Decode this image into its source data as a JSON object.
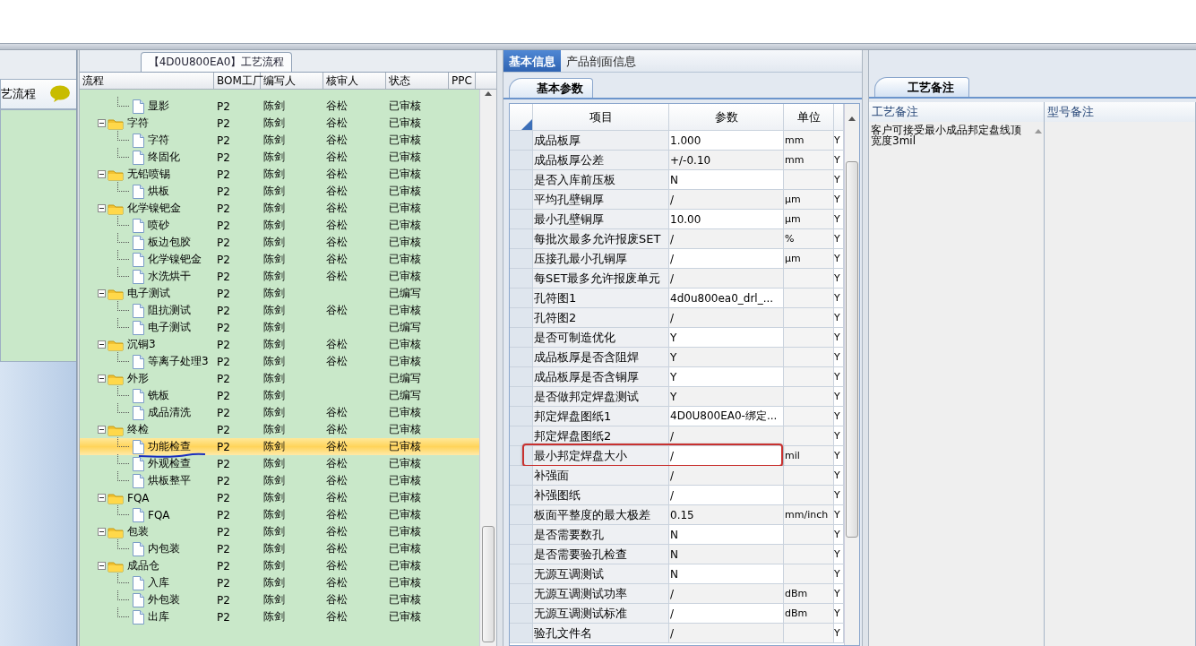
{
  "side_panel": {
    "title": "艺流程"
  },
  "flow_panel": {
    "tab": {
      "label": "【4D0U800EA0】工艺流程",
      "selected": true
    },
    "columns": [
      "流程",
      "BOM工厂",
      "编写人",
      "核审人",
      "状态",
      "PPC"
    ],
    "tree": [
      {
        "children": [
          {
            "label": "显影",
            "factory": "P2",
            "writer": "陈剑",
            "reviewer": "谷松",
            "status": "已审核",
            "selected": false
          }
        ]
      },
      {
        "label": "字符",
        "factory": "P2",
        "writer": "陈剑",
        "reviewer": "谷松",
        "status": "已审核",
        "selected": false,
        "expanded": true,
        "children": [
          {
            "label": "字符",
            "factory": "P2",
            "writer": "陈剑",
            "reviewer": "谷松",
            "status": "已审核",
            "selected": false
          },
          {
            "label": "终固化",
            "factory": "P2",
            "writer": "陈剑",
            "reviewer": "谷松",
            "status": "已审核",
            "selected": false
          }
        ]
      },
      {
        "label": "无铅喷锡",
        "factory": "P2",
        "writer": "陈剑",
        "reviewer": "谷松",
        "status": "已审核",
        "selected": false,
        "expanded": true,
        "children": [
          {
            "label": "烘板",
            "factory": "P2",
            "writer": "陈剑",
            "reviewer": "谷松",
            "status": "已审核",
            "selected": false
          }
        ]
      },
      {
        "label": "化学镍钯金",
        "factory": "P2",
        "writer": "陈剑",
        "reviewer": "谷松",
        "status": "已审核",
        "selected": false,
        "expanded": true,
        "children": [
          {
            "label": "喷砂",
            "factory": "P2",
            "writer": "陈剑",
            "reviewer": "谷松",
            "status": "已审核",
            "selected": false
          },
          {
            "label": "板边包胶",
            "factory": "P2",
            "writer": "陈剑",
            "reviewer": "谷松",
            "status": "已审核",
            "selected": false
          },
          {
            "label": "化学镍钯金",
            "factory": "P2",
            "writer": "陈剑",
            "reviewer": "谷松",
            "status": "已审核",
            "selected": false
          },
          {
            "label": "水洗烘干",
            "factory": "P2",
            "writer": "陈剑",
            "reviewer": "谷松",
            "status": "已审核",
            "selected": false
          }
        ]
      },
      {
        "label": "电子测试",
        "factory": "P2",
        "writer": "陈剑",
        "status": "已编写",
        "selected": false,
        "expanded": true,
        "children": [
          {
            "label": "阻抗测试",
            "factory": "P2",
            "writer": "陈剑",
            "reviewer": "谷松",
            "status": "已审核",
            "selected": false
          },
          {
            "label": "电子测试",
            "factory": "P2",
            "writer": "陈剑",
            "status": "已编写",
            "selected": false
          }
        ]
      },
      {
        "label": "沉铜3",
        "factory": "P2",
        "writer": "陈剑",
        "reviewer": "谷松",
        "status": "已审核",
        "selected": false,
        "expanded": true,
        "children": [
          {
            "label": "等离子处理3",
            "factory": "P2",
            "writer": "陈剑",
            "reviewer": "谷松",
            "status": "已审核",
            "selected": false
          }
        ]
      },
      {
        "label": "外形",
        "factory": "P2",
        "writer": "陈剑",
        "status": "已编写",
        "selected": false,
        "expanded": true,
        "children": [
          {
            "label": "铣板",
            "factory": "P2",
            "writer": "陈剑",
            "status": "已编写",
            "selected": false
          },
          {
            "label": "成品清洗",
            "factory": "P2",
            "writer": "陈剑",
            "reviewer": "谷松",
            "status": "已审核",
            "selected": false
          }
        ]
      },
      {
        "label": "终检",
        "factory": "P2",
        "writer": "陈剑",
        "reviewer": "谷松",
        "status": "已审核",
        "selected": false,
        "expanded": true,
        "children": [
          {
            "label": "功能检查",
            "factory": "P2",
            "writer": "陈剑",
            "reviewer": "谷松",
            "status": "已审核",
            "selected": true
          },
          {
            "label": "外观检查",
            "factory": "P2",
            "writer": "陈剑",
            "reviewer": "谷松",
            "status": "已审核",
            "selected": false
          },
          {
            "label": "烘板整平",
            "factory": "P2",
            "writer": "陈剑",
            "reviewer": "谷松",
            "status": "已审核",
            "selected": false
          }
        ]
      },
      {
        "label": "FQA",
        "factory": "P2",
        "writer": "陈剑",
        "reviewer": "谷松",
        "status": "已审核",
        "selected": false,
        "expanded": true,
        "children": [
          {
            "label": "FQA",
            "factory": "P2",
            "writer": "陈剑",
            "reviewer": "谷松",
            "status": "已审核",
            "selected": false
          }
        ]
      },
      {
        "label": "包装",
        "factory": "P2",
        "writer": "陈剑",
        "reviewer": "谷松",
        "status": "已审核",
        "selected": false,
        "expanded": true,
        "children": [
          {
            "label": "内包装",
            "factory": "P2",
            "writer": "陈剑",
            "reviewer": "谷松",
            "status": "已审核",
            "selected": false
          }
        ]
      },
      {
        "label": "成品仓",
        "factory": "P2",
        "writer": "陈剑",
        "reviewer": "谷松",
        "status": "已审核",
        "selected": false,
        "expanded": true,
        "children": [
          {
            "label": "入库",
            "factory": "P2",
            "writer": "陈剑",
            "reviewer": "谷松",
            "status": "已审核",
            "selected": false
          },
          {
            "label": "外包装",
            "factory": "P2",
            "writer": "陈剑",
            "reviewer": "谷松",
            "status": "已审核",
            "selected": false
          },
          {
            "label": "出库",
            "factory": "P2",
            "writer": "陈剑",
            "reviewer": "谷松",
            "status": "已审核",
            "selected": false
          }
        ]
      }
    ]
  },
  "info_panel": {
    "tabs": [
      {
        "label": "基本信息",
        "selected": true
      },
      {
        "label": "产品剖面信息",
        "selected": false
      }
    ],
    "sub_tab": {
      "label": "基本参数",
      "selected": true
    },
    "columns": [
      "项目",
      "参数",
      "单位"
    ],
    "rows": [
      {
        "item": "成品板厚",
        "value": "1.000",
        "unit": "mm",
        "flag": "Y",
        "marked": false
      },
      {
        "item": "成品板厚公差",
        "value": "+/-0.10",
        "unit": "mm",
        "flag": "Y",
        "marked": false
      },
      {
        "item": "是否入库前压板",
        "value": "N",
        "flag": "Y",
        "marked": false
      },
      {
        "item": "平均孔壁铜厚",
        "value": "/",
        "unit": "μm",
        "flag": "Y",
        "marked": false
      },
      {
        "item": "最小孔壁铜厚",
        "value": "10.00",
        "unit": "μm",
        "flag": "Y",
        "marked": false
      },
      {
        "item": "每批次最多允许报废SET",
        "value": "/",
        "unit": "%",
        "flag": "Y",
        "marked": false
      },
      {
        "item": "压接孔最小孔铜厚",
        "value": "/",
        "unit": "μm",
        "flag": "Y",
        "marked": false
      },
      {
        "item": "每SET最多允许报废单元",
        "value": "/",
        "flag": "Y",
        "marked": false
      },
      {
        "item": "孔符图1",
        "value": "4d0u800ea0_drl_...",
        "flag": "Y",
        "marked": false
      },
      {
        "item": "孔符图2",
        "value": "/",
        "flag": "Y",
        "marked": false
      },
      {
        "item": "是否可制造优化",
        "value": "Y",
        "flag": "Y",
        "marked": false
      },
      {
        "item": "成品板厚是否含阻焊",
        "value": "Y",
        "flag": "Y",
        "marked": false
      },
      {
        "item": "成品板厚是否含铜厚",
        "value": "Y",
        "flag": "Y",
        "marked": false
      },
      {
        "item": "是否做邦定焊盘测试",
        "value": "Y",
        "flag": "Y",
        "marked": false
      },
      {
        "item": "邦定焊盘图纸1",
        "value": "4D0U800EA0-绑定...",
        "flag": "Y",
        "marked": false
      },
      {
        "item": "邦定焊盘图纸2",
        "value": "/",
        "flag": "Y",
        "marked": false
      },
      {
        "item": "最小邦定焊盘大小",
        "value": "/",
        "unit": "mil",
        "flag": "Y",
        "marked": true
      },
      {
        "item": "补强面",
        "value": "/",
        "flag": "Y",
        "marked": false
      },
      {
        "item": "补强图纸",
        "value": "/",
        "flag": "Y",
        "marked": false
      },
      {
        "item": "板面平整度的最大极差",
        "value": "0.15",
        "unit": "mm/inch",
        "flag": "Y",
        "marked": false
      },
      {
        "item": "是否需要数孔",
        "value": "N",
        "flag": "Y",
        "marked": false
      },
      {
        "item": "是否需要验孔检查",
        "value": "N",
        "flag": "Y",
        "marked": false
      },
      {
        "item": "无源互调测试",
        "value": "N",
        "flag": "Y",
        "marked": false
      },
      {
        "item": "无源互调测试功率",
        "value": "/",
        "unit": "dBm",
        "flag": "Y",
        "marked": false
      },
      {
        "item": "无源互调测试标准",
        "value": "/",
        "unit": "dBm",
        "flag": "Y",
        "marked": false
      },
      {
        "item": "验孔文件名",
        "value": "/",
        "flag": "Y",
        "marked": false
      }
    ]
  },
  "notes_panel": {
    "tab": {
      "label": "工艺备注",
      "selected": true
    },
    "columns": [
      "工艺备注",
      "型号备注"
    ],
    "process_note": "客户可接受最小成品邦定盘线顶宽度3mil"
  }
}
